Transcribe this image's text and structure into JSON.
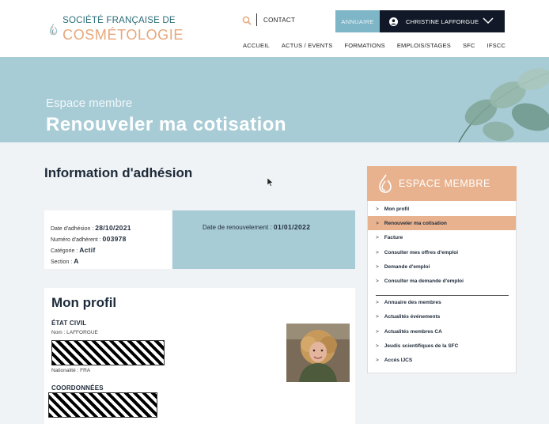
{
  "logo": {
    "line1": "SOCIÉTÉ FRANÇAISE DE",
    "line2": "COSMÉTOLOGIE"
  },
  "header": {
    "contact": "CONTACT",
    "annuaire": "ANNUAIRE",
    "user_name": "CHRISTINE LAFFORGUE",
    "nav": [
      "ACCUEIL",
      "ACTUS / EVENTS",
      "FORMATIONS",
      "EMPLOIS/STAGES",
      "SFC",
      "IFSCC"
    ]
  },
  "banner": {
    "subtitle": "Espace membre",
    "title": "Renouveler ma cotisation"
  },
  "info": {
    "title": "Information d'adhésion",
    "date_adhesion_label": "Date d'adhésion : ",
    "date_adhesion": "28/10/2021",
    "numero_label": "Numéro d'adhérent : ",
    "numero": "003978",
    "categorie_label": "Catégorie : ",
    "categorie": "Actif",
    "section_label": "Section : ",
    "section": "A",
    "renouvellement_label": "Date de renouvelement : ",
    "renouvellement": "01/01/2022"
  },
  "profil": {
    "title": "Mon profil",
    "etat_civil": "ÉTAT CIVIL",
    "nom": "Nom : LAFFORGUE",
    "nationalite": "Nationalité : FRA",
    "coordonnees": "COORDONNÉES"
  },
  "sidebar": {
    "title": "ESPACE MEMBRE",
    "group1": [
      "Mon profil",
      "Renouveler ma cotisation",
      "Facture",
      "Consulter mes offres d'emploi",
      "Demande d'emploi",
      "Consulter ma demande d'emploi"
    ],
    "group2": [
      "Annuaire des membres",
      "Actualités événements",
      "Actualités membres CA",
      "Jeudis scientifiques de la SFC",
      "Accès IJCS"
    ],
    "arrow": ">"
  },
  "colors": {
    "accent_peach": "#e8b28f",
    "banner_blue": "#a8ccd6",
    "dark": "#111827",
    "annuaire_blue": "#7eb5c7"
  }
}
